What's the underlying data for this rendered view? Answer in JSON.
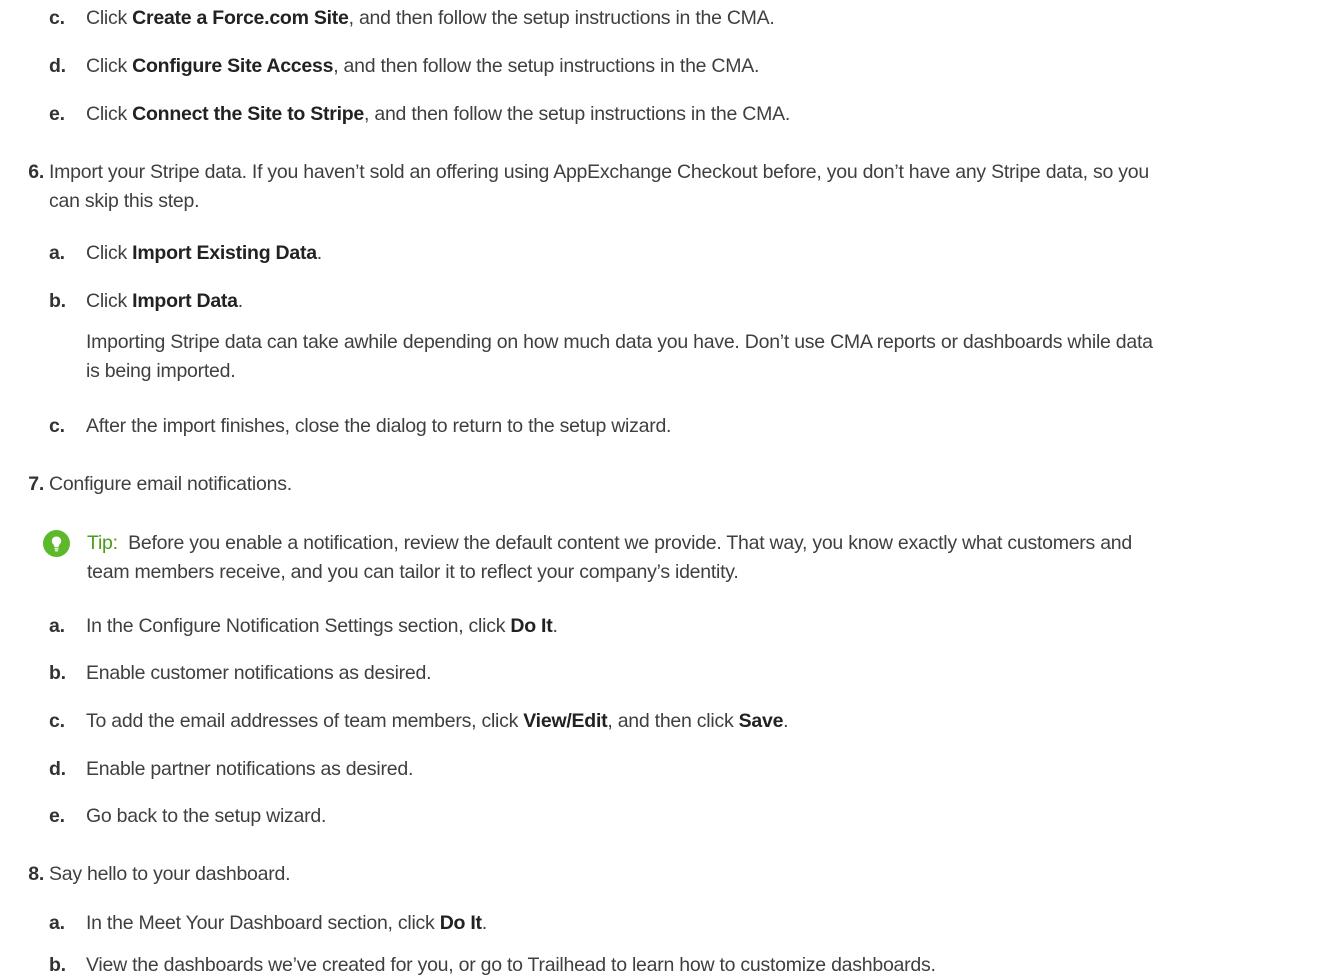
{
  "items": {
    "c1": {
      "m": "c.",
      "pre": "Click ",
      "b": "Create a Force.com Site",
      "post": ", and then follow the setup instructions in the CMA."
    },
    "d1": {
      "m": "d.",
      "pre": "Click ",
      "b": "Configure Site Access",
      "post": ", and then follow the setup instructions in the CMA."
    },
    "e1": {
      "m": "e.",
      "pre": "Click ",
      "b": "Connect the Site to Stripe",
      "post": ", and then follow the setup instructions in the CMA."
    },
    "s6": {
      "n": "6.",
      "l1": "Import your Stripe data. If you haven’t sold an offering using AppExchange Checkout before, you don’t have any Stripe data, so you",
      "l2": "can skip this step."
    },
    "a6": {
      "m": "a.",
      "pre": "Click ",
      "b": "Import Existing Data",
      "post": "."
    },
    "b6": {
      "m": "b.",
      "pre": "Click ",
      "b": "Import Data",
      "post": "."
    },
    "note6": {
      "l1": "Importing Stripe data can take awhile depending on how much data you have. Don’t use CMA reports or dashboards while data",
      "l2": "is being imported."
    },
    "c6": {
      "m": "c.",
      "text": "After the import finishes, close the dialog to return to the setup wizard."
    },
    "s7": {
      "n": "7.",
      "text": "Configure email notifications."
    },
    "tip": {
      "label": "Tip:",
      "l1": "Before you enable a notification, review the default content we provide. That way, you know exactly what customers and",
      "l2": "team members receive, and you can tailor it to reflect your company’s identity.",
      "icon": "lightbulb-icon",
      "color": "#5db82a"
    },
    "a7": {
      "m": "a.",
      "pre": "In the Configure Notification Settings section, click ",
      "b": "Do It",
      "post": "."
    },
    "b7": {
      "m": "b.",
      "text": "Enable customer notifications as desired."
    },
    "c7": {
      "m": "c.",
      "pre": "To add the email addresses of team members, click ",
      "b": "View/Edit",
      "mid": ", and then click ",
      "b2": "Save",
      "post": "."
    },
    "d7": {
      "m": "d.",
      "text": "Enable partner notifications as desired."
    },
    "e7": {
      "m": "e.",
      "text": "Go back to the setup wizard."
    },
    "s8": {
      "n": "8.",
      "text": "Say hello to your dashboard."
    },
    "a8": {
      "m": "a.",
      "pre": "In the Meet Your Dashboard section, click ",
      "b": "Do It",
      "post": "."
    },
    "b8": {
      "m": "b.",
      "text": "View the dashboards we’ve created for you, or go to Trailhead to learn how to customize dashboards."
    }
  }
}
